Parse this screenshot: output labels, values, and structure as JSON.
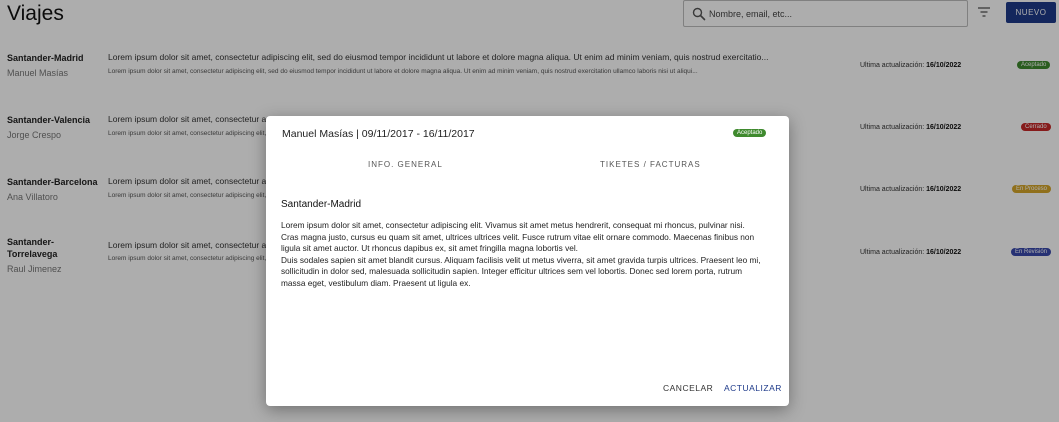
{
  "header": {
    "title": "Viajes",
    "search_placeholder": "Nombre, email, etc...",
    "new_label": "NUEVO"
  },
  "rows": [
    {
      "route": "Santander-Madrid",
      "person": "Manuel Masías",
      "desc_main": "Lorem ipsum dolor sit amet, consectetur adipiscing elit, sed do eiusmod tempor incididunt ut labore et dolore magna aliqua. Ut enim ad minim veniam, quis nostrud exercitatio...",
      "desc_sub": "Lorem ipsum dolor sit amet, consectetur adipiscing elit, sed do eiusmod tempor incididunt ut labore et dolore magna aliqua. Ut enim ad minim veniam, quis nostrud exercitation ullamco laboris nisi ut aliqui...",
      "update_label": "Ultima actualización: ",
      "update_date": "16/10/2022",
      "status": "Aceptado",
      "status_color": "#3f8a2e"
    },
    {
      "route": "Santander-Valencia",
      "person": "Jorge Crespo",
      "desc_main": "Lorem ipsum dolor sit amet, consectetur adipiscing elit, sed do eiusmod tempor incididunt ut labore et dolore magna aliqua. Ut enim ad minim veniam, quis nostrud exercitatio...",
      "desc_sub": "Lorem ipsum dolor sit amet, consectetur adipiscing elit, sed do eiusmod tempor incididunt ut labore et dolore magna aliqua. Ut enim ad minim veniam, quis nostrud exercitation ullamco laboris nisi ut aliqui...",
      "update_label": "Ultima actualización: ",
      "update_date": "16/10/2022",
      "status": "Cerrado",
      "status_color": "#c62828"
    },
    {
      "route": "Santander-Barcelona",
      "person": "Ana Villatoro",
      "desc_main": "Lorem ipsum dolor sit amet, consectetur adipiscing elit, sed do eiusmod tempor incididunt ut labore et dolore magna aliqua. Ut enim ad minim veniam, quis nostrud exercitatio...",
      "desc_sub": "Lorem ipsum dolor sit amet, consectetur adipiscing elit, sed do eiusmod tempor incididunt ut labore et dolore magna aliqua. Ut enim ad minim veniam, quis nostrud exercitation ullamco laboris nisi ut aliqui...",
      "update_label": "Ultima actualización: ",
      "update_date": "16/10/2022",
      "status": "En Proceso",
      "status_color": "#d4a62a"
    },
    {
      "route": "Santander-Torrelavega",
      "person": "Raul Jimenez",
      "desc_main": "Lorem ipsum dolor sit amet, consectetur adipiscing elit, sed do eiusmod tempor incididunt ut labore et dolore magna aliqua. Ut enim ad minim veniam, quis nostrud exercitatio...",
      "desc_sub": "Lorem ipsum dolor sit amet, consectetur adipiscing elit, sed do eiusmod tempor incididunt ut labore et dolore magna aliqua. Ut enim ad minim veniam, quis nostrud exercitation ullamco laboris nisi ut aliqui...",
      "update_label": "Ultima actualización: ",
      "update_date": "16/10/2022",
      "status": "En Revisión",
      "status_color": "#3949ab"
    }
  ],
  "modal": {
    "title": "Manuel Masías | 09/11/2017 - 16/11/2017",
    "status": "Aceptado",
    "tab_info": "INFO. GENERAL",
    "tab_tickets": "TIKETES / FACTURAS",
    "section_title": "Santander-Madrid",
    "body": "Lorem ipsum dolor sit amet, consectetur adipiscing elit. Vivamus sit amet metus hendrerit, consequat mi rhoncus, pulvinar nisi. Cras magna justo, cursus eu quam sit amet, ultrices ultrices velit. Fusce rutrum vitae elit ornare commodo. Maecenas finibus non ligula sit amet auctor. Ut rhoncus dapibus ex, sit amet fringilla magna lobortis vel.\nDuis sodales sapien sit amet blandit cursus. Aliquam facilisis velit ut metus viverra, sit amet gravida turpis ultrices. Praesent leo mi, sollicitudin in dolor sed, malesuada sollicitudin sapien. Integer efficitur ultrices sem vel lobortis. Donec sed lorem porta, rutrum massa eget, vestibulum diam. Praesent ut ligula ex.",
    "cancel_label": "CANCELAR",
    "update_label": "ACTUALIZAR"
  },
  "icons": {
    "search": "search-icon",
    "filter": "filter-icon"
  },
  "colors": {
    "primary": "#1e3a8a",
    "overlay": "rgba(0,0,0,0.32)"
  }
}
